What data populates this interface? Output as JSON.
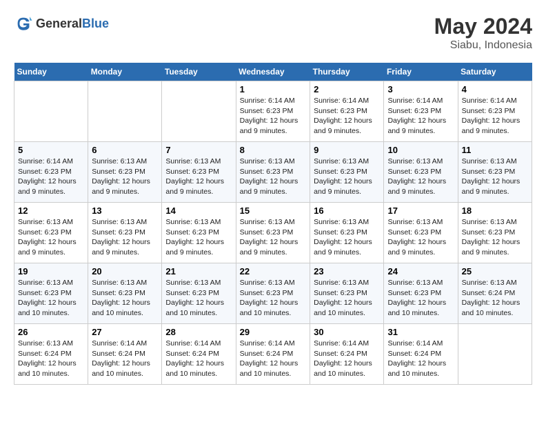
{
  "header": {
    "logo_general": "General",
    "logo_blue": "Blue",
    "title": "May 2024",
    "location": "Siabu, Indonesia"
  },
  "days_of_week": [
    "Sunday",
    "Monday",
    "Tuesday",
    "Wednesday",
    "Thursday",
    "Friday",
    "Saturday"
  ],
  "weeks": [
    [
      {
        "day": "",
        "info": ""
      },
      {
        "day": "",
        "info": ""
      },
      {
        "day": "",
        "info": ""
      },
      {
        "day": "1",
        "info": "Sunrise: 6:14 AM\nSunset: 6:23 PM\nDaylight: 12 hours and 9 minutes."
      },
      {
        "day": "2",
        "info": "Sunrise: 6:14 AM\nSunset: 6:23 PM\nDaylight: 12 hours and 9 minutes."
      },
      {
        "day": "3",
        "info": "Sunrise: 6:14 AM\nSunset: 6:23 PM\nDaylight: 12 hours and 9 minutes."
      },
      {
        "day": "4",
        "info": "Sunrise: 6:14 AM\nSunset: 6:23 PM\nDaylight: 12 hours and 9 minutes."
      }
    ],
    [
      {
        "day": "5",
        "info": "Sunrise: 6:14 AM\nSunset: 6:23 PM\nDaylight: 12 hours and 9 minutes."
      },
      {
        "day": "6",
        "info": "Sunrise: 6:13 AM\nSunset: 6:23 PM\nDaylight: 12 hours and 9 minutes."
      },
      {
        "day": "7",
        "info": "Sunrise: 6:13 AM\nSunset: 6:23 PM\nDaylight: 12 hours and 9 minutes."
      },
      {
        "day": "8",
        "info": "Sunrise: 6:13 AM\nSunset: 6:23 PM\nDaylight: 12 hours and 9 minutes."
      },
      {
        "day": "9",
        "info": "Sunrise: 6:13 AM\nSunset: 6:23 PM\nDaylight: 12 hours and 9 minutes."
      },
      {
        "day": "10",
        "info": "Sunrise: 6:13 AM\nSunset: 6:23 PM\nDaylight: 12 hours and 9 minutes."
      },
      {
        "day": "11",
        "info": "Sunrise: 6:13 AM\nSunset: 6:23 PM\nDaylight: 12 hours and 9 minutes."
      }
    ],
    [
      {
        "day": "12",
        "info": "Sunrise: 6:13 AM\nSunset: 6:23 PM\nDaylight: 12 hours and 9 minutes."
      },
      {
        "day": "13",
        "info": "Sunrise: 6:13 AM\nSunset: 6:23 PM\nDaylight: 12 hours and 9 minutes."
      },
      {
        "day": "14",
        "info": "Sunrise: 6:13 AM\nSunset: 6:23 PM\nDaylight: 12 hours and 9 minutes."
      },
      {
        "day": "15",
        "info": "Sunrise: 6:13 AM\nSunset: 6:23 PM\nDaylight: 12 hours and 9 minutes."
      },
      {
        "day": "16",
        "info": "Sunrise: 6:13 AM\nSunset: 6:23 PM\nDaylight: 12 hours and 9 minutes."
      },
      {
        "day": "17",
        "info": "Sunrise: 6:13 AM\nSunset: 6:23 PM\nDaylight: 12 hours and 9 minutes."
      },
      {
        "day": "18",
        "info": "Sunrise: 6:13 AM\nSunset: 6:23 PM\nDaylight: 12 hours and 9 minutes."
      }
    ],
    [
      {
        "day": "19",
        "info": "Sunrise: 6:13 AM\nSunset: 6:23 PM\nDaylight: 12 hours and 10 minutes."
      },
      {
        "day": "20",
        "info": "Sunrise: 6:13 AM\nSunset: 6:23 PM\nDaylight: 12 hours and 10 minutes."
      },
      {
        "day": "21",
        "info": "Sunrise: 6:13 AM\nSunset: 6:23 PM\nDaylight: 12 hours and 10 minutes."
      },
      {
        "day": "22",
        "info": "Sunrise: 6:13 AM\nSunset: 6:23 PM\nDaylight: 12 hours and 10 minutes."
      },
      {
        "day": "23",
        "info": "Sunrise: 6:13 AM\nSunset: 6:23 PM\nDaylight: 12 hours and 10 minutes."
      },
      {
        "day": "24",
        "info": "Sunrise: 6:13 AM\nSunset: 6:23 PM\nDaylight: 12 hours and 10 minutes."
      },
      {
        "day": "25",
        "info": "Sunrise: 6:13 AM\nSunset: 6:24 PM\nDaylight: 12 hours and 10 minutes."
      }
    ],
    [
      {
        "day": "26",
        "info": "Sunrise: 6:13 AM\nSunset: 6:24 PM\nDaylight: 12 hours and 10 minutes."
      },
      {
        "day": "27",
        "info": "Sunrise: 6:14 AM\nSunset: 6:24 PM\nDaylight: 12 hours and 10 minutes."
      },
      {
        "day": "28",
        "info": "Sunrise: 6:14 AM\nSunset: 6:24 PM\nDaylight: 12 hours and 10 minutes."
      },
      {
        "day": "29",
        "info": "Sunrise: 6:14 AM\nSunset: 6:24 PM\nDaylight: 12 hours and 10 minutes."
      },
      {
        "day": "30",
        "info": "Sunrise: 6:14 AM\nSunset: 6:24 PM\nDaylight: 12 hours and 10 minutes."
      },
      {
        "day": "31",
        "info": "Sunrise: 6:14 AM\nSunset: 6:24 PM\nDaylight: 12 hours and 10 minutes."
      },
      {
        "day": "",
        "info": ""
      }
    ]
  ]
}
